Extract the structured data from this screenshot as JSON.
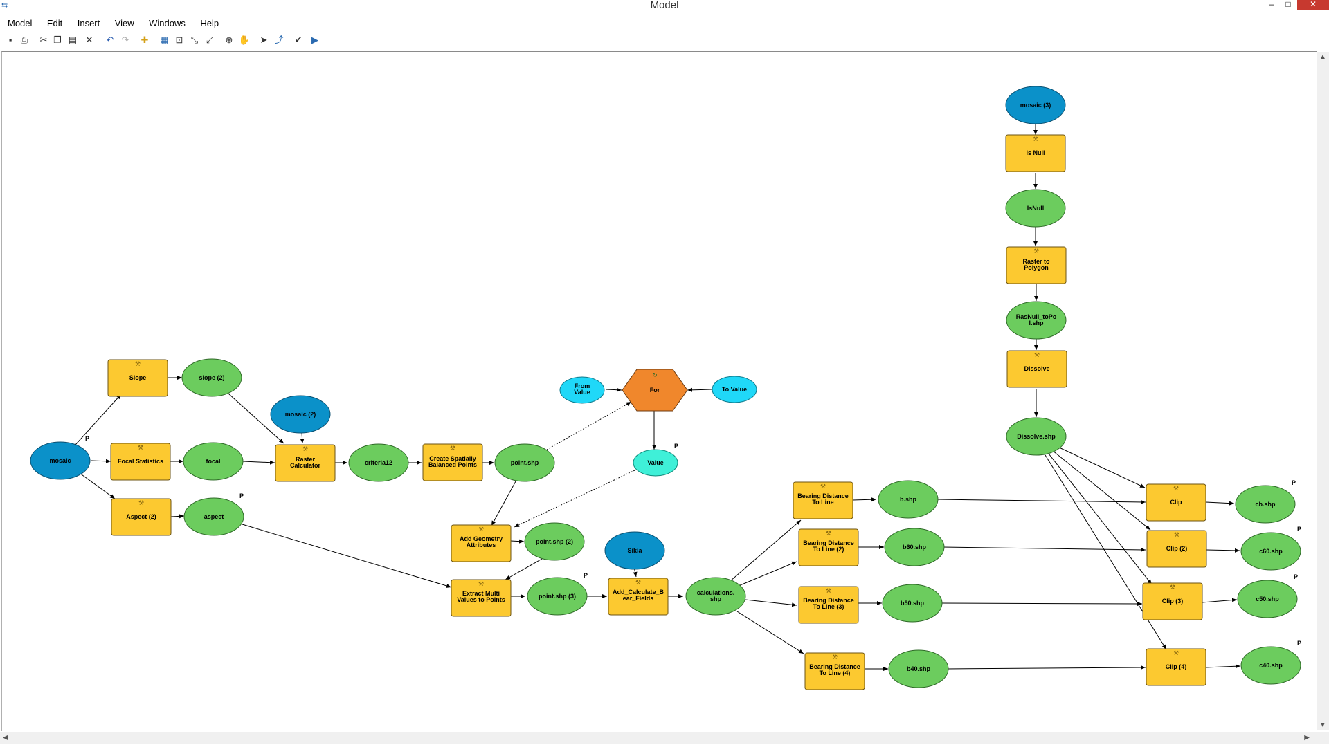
{
  "window": {
    "title": "Model"
  },
  "menu": [
    "Model",
    "Edit",
    "Insert",
    "View",
    "Windows",
    "Help"
  ],
  "toolbar": {
    "icons": [
      "save-icon",
      "print-icon",
      "cut-icon",
      "copy-icon",
      "paste-icon",
      "delete-icon",
      "undo-icon",
      "redo-icon",
      "add-data-icon",
      "auto-layout-icon",
      "full-extent-icon",
      "fit-icon",
      "zoom-icon",
      "zoom-in-icon",
      "pan-icon",
      "select-icon",
      "connect-icon",
      "validate-icon",
      "run-icon"
    ]
  },
  "colors": {
    "tool": "#fcc930",
    "derived": "#6ccc5e",
    "input": "#0b91c9",
    "iterator": "#f0872c",
    "variable": "#20d8f8",
    "value": "#3ff0d8"
  },
  "nodes": {
    "slope_tool": "Slope",
    "focal_tool": "Focal Statistics",
    "aspect_tool": "Aspect (2)",
    "mosaic": "mosaic",
    "slope2": "slope (2)",
    "focal": "focal",
    "aspect": "aspect",
    "mosaic2": "mosaic (2)",
    "raster_calc_1": "Raster",
    "raster_calc_2": "Calculator",
    "criteria12": "criteria12",
    "create_pts_1": "Create Spatially",
    "create_pts_2": "Balanced Points",
    "point_shp": "point.shp",
    "from_value_1": "From",
    "from_value_2": "Value",
    "for": "For",
    "to_value": "To Value",
    "value": "Value",
    "add_geom_1": "Add Geometry",
    "add_geom_2": "Attributes",
    "point_shp2": "point.shp (2)",
    "extract_1": "Extract Multi",
    "extract_2": "Values to Points",
    "point_shp3": "point.shp (3)",
    "sikia": "Sikia",
    "add_calc_1": "Add_Calculate_B",
    "add_calc_2": "ear_Fields",
    "calc_shp_1": "calculations.",
    "calc_shp_2": "shp",
    "bdl_1a": "Bearing Distance",
    "bdl_1b": "To Line",
    "bdl_2a": "Bearing Distance",
    "bdl_2b": "To Line (2)",
    "bdl_3a": "Bearing Distance",
    "bdl_3b": "To Line (3)",
    "bdl_4a": "Bearing Distance",
    "bdl_4b": "To Line (4)",
    "b_shp": "b.shp",
    "b60_shp": "b60.shp",
    "b50_shp": "b50.shp",
    "b40_shp": "b40.shp",
    "mosaic3": "mosaic (3)",
    "isnull_tool": "Is Null",
    "isnull": "IsNull",
    "r2p_1": "Raster to",
    "r2p_2": "Polygon",
    "rasnull_1": "RasNull_toPo",
    "rasnull_2": "l.shp",
    "dissolve_tool": "Dissolve",
    "dissolve_shp": "Dissolve.shp",
    "clip": "Clip",
    "clip2": "Clip (2)",
    "clip3": "Clip (3)",
    "clip4": "Clip (4)",
    "cb_shp": "cb.shp",
    "c60_shp": "c60.shp",
    "c50_shp": "c50.shp",
    "c40_shp": "c40.shp",
    "p": "P"
  }
}
